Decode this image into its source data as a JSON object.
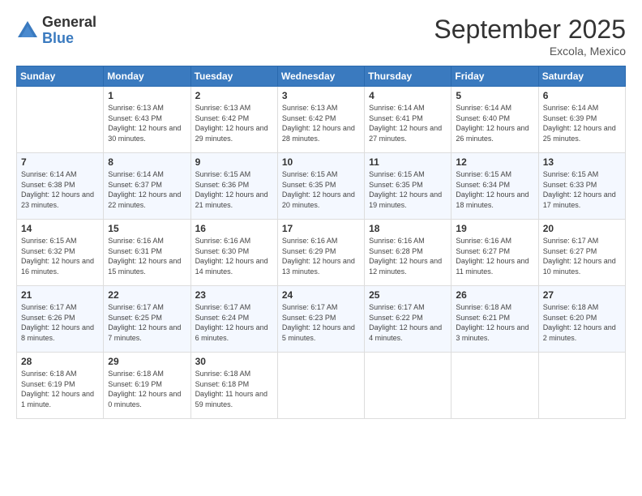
{
  "logo": {
    "general": "General",
    "blue": "Blue"
  },
  "title": {
    "month": "September 2025",
    "location": "Excola, Mexico"
  },
  "weekdays": [
    "Sunday",
    "Monday",
    "Tuesday",
    "Wednesday",
    "Thursday",
    "Friday",
    "Saturday"
  ],
  "weeks": [
    [
      {
        "day": "",
        "sunrise": "",
        "sunset": "",
        "daylight": ""
      },
      {
        "day": "1",
        "sunrise": "Sunrise: 6:13 AM",
        "sunset": "Sunset: 6:43 PM",
        "daylight": "Daylight: 12 hours and 30 minutes."
      },
      {
        "day": "2",
        "sunrise": "Sunrise: 6:13 AM",
        "sunset": "Sunset: 6:42 PM",
        "daylight": "Daylight: 12 hours and 29 minutes."
      },
      {
        "day": "3",
        "sunrise": "Sunrise: 6:13 AM",
        "sunset": "Sunset: 6:42 PM",
        "daylight": "Daylight: 12 hours and 28 minutes."
      },
      {
        "day": "4",
        "sunrise": "Sunrise: 6:14 AM",
        "sunset": "Sunset: 6:41 PM",
        "daylight": "Daylight: 12 hours and 27 minutes."
      },
      {
        "day": "5",
        "sunrise": "Sunrise: 6:14 AM",
        "sunset": "Sunset: 6:40 PM",
        "daylight": "Daylight: 12 hours and 26 minutes."
      },
      {
        "day": "6",
        "sunrise": "Sunrise: 6:14 AM",
        "sunset": "Sunset: 6:39 PM",
        "daylight": "Daylight: 12 hours and 25 minutes."
      }
    ],
    [
      {
        "day": "7",
        "sunrise": "Sunrise: 6:14 AM",
        "sunset": "Sunset: 6:38 PM",
        "daylight": "Daylight: 12 hours and 23 minutes."
      },
      {
        "day": "8",
        "sunrise": "Sunrise: 6:14 AM",
        "sunset": "Sunset: 6:37 PM",
        "daylight": "Daylight: 12 hours and 22 minutes."
      },
      {
        "day": "9",
        "sunrise": "Sunrise: 6:15 AM",
        "sunset": "Sunset: 6:36 PM",
        "daylight": "Daylight: 12 hours and 21 minutes."
      },
      {
        "day": "10",
        "sunrise": "Sunrise: 6:15 AM",
        "sunset": "Sunset: 6:35 PM",
        "daylight": "Daylight: 12 hours and 20 minutes."
      },
      {
        "day": "11",
        "sunrise": "Sunrise: 6:15 AM",
        "sunset": "Sunset: 6:35 PM",
        "daylight": "Daylight: 12 hours and 19 minutes."
      },
      {
        "day": "12",
        "sunrise": "Sunrise: 6:15 AM",
        "sunset": "Sunset: 6:34 PM",
        "daylight": "Daylight: 12 hours and 18 minutes."
      },
      {
        "day": "13",
        "sunrise": "Sunrise: 6:15 AM",
        "sunset": "Sunset: 6:33 PM",
        "daylight": "Daylight: 12 hours and 17 minutes."
      }
    ],
    [
      {
        "day": "14",
        "sunrise": "Sunrise: 6:15 AM",
        "sunset": "Sunset: 6:32 PM",
        "daylight": "Daylight: 12 hours and 16 minutes."
      },
      {
        "day": "15",
        "sunrise": "Sunrise: 6:16 AM",
        "sunset": "Sunset: 6:31 PM",
        "daylight": "Daylight: 12 hours and 15 minutes."
      },
      {
        "day": "16",
        "sunrise": "Sunrise: 6:16 AM",
        "sunset": "Sunset: 6:30 PM",
        "daylight": "Daylight: 12 hours and 14 minutes."
      },
      {
        "day": "17",
        "sunrise": "Sunrise: 6:16 AM",
        "sunset": "Sunset: 6:29 PM",
        "daylight": "Daylight: 12 hours and 13 minutes."
      },
      {
        "day": "18",
        "sunrise": "Sunrise: 6:16 AM",
        "sunset": "Sunset: 6:28 PM",
        "daylight": "Daylight: 12 hours and 12 minutes."
      },
      {
        "day": "19",
        "sunrise": "Sunrise: 6:16 AM",
        "sunset": "Sunset: 6:27 PM",
        "daylight": "Daylight: 12 hours and 11 minutes."
      },
      {
        "day": "20",
        "sunrise": "Sunrise: 6:17 AM",
        "sunset": "Sunset: 6:27 PM",
        "daylight": "Daylight: 12 hours and 10 minutes."
      }
    ],
    [
      {
        "day": "21",
        "sunrise": "Sunrise: 6:17 AM",
        "sunset": "Sunset: 6:26 PM",
        "daylight": "Daylight: 12 hours and 8 minutes."
      },
      {
        "day": "22",
        "sunrise": "Sunrise: 6:17 AM",
        "sunset": "Sunset: 6:25 PM",
        "daylight": "Daylight: 12 hours and 7 minutes."
      },
      {
        "day": "23",
        "sunrise": "Sunrise: 6:17 AM",
        "sunset": "Sunset: 6:24 PM",
        "daylight": "Daylight: 12 hours and 6 minutes."
      },
      {
        "day": "24",
        "sunrise": "Sunrise: 6:17 AM",
        "sunset": "Sunset: 6:23 PM",
        "daylight": "Daylight: 12 hours and 5 minutes."
      },
      {
        "day": "25",
        "sunrise": "Sunrise: 6:17 AM",
        "sunset": "Sunset: 6:22 PM",
        "daylight": "Daylight: 12 hours and 4 minutes."
      },
      {
        "day": "26",
        "sunrise": "Sunrise: 6:18 AM",
        "sunset": "Sunset: 6:21 PM",
        "daylight": "Daylight: 12 hours and 3 minutes."
      },
      {
        "day": "27",
        "sunrise": "Sunrise: 6:18 AM",
        "sunset": "Sunset: 6:20 PM",
        "daylight": "Daylight: 12 hours and 2 minutes."
      }
    ],
    [
      {
        "day": "28",
        "sunrise": "Sunrise: 6:18 AM",
        "sunset": "Sunset: 6:19 PM",
        "daylight": "Daylight: 12 hours and 1 minute."
      },
      {
        "day": "29",
        "sunrise": "Sunrise: 6:18 AM",
        "sunset": "Sunset: 6:19 PM",
        "daylight": "Daylight: 12 hours and 0 minutes."
      },
      {
        "day": "30",
        "sunrise": "Sunrise: 6:18 AM",
        "sunset": "Sunset: 6:18 PM",
        "daylight": "Daylight: 11 hours and 59 minutes."
      },
      {
        "day": "",
        "sunrise": "",
        "sunset": "",
        "daylight": ""
      },
      {
        "day": "",
        "sunrise": "",
        "sunset": "",
        "daylight": ""
      },
      {
        "day": "",
        "sunrise": "",
        "sunset": "",
        "daylight": ""
      },
      {
        "day": "",
        "sunrise": "",
        "sunset": "",
        "daylight": ""
      }
    ]
  ]
}
